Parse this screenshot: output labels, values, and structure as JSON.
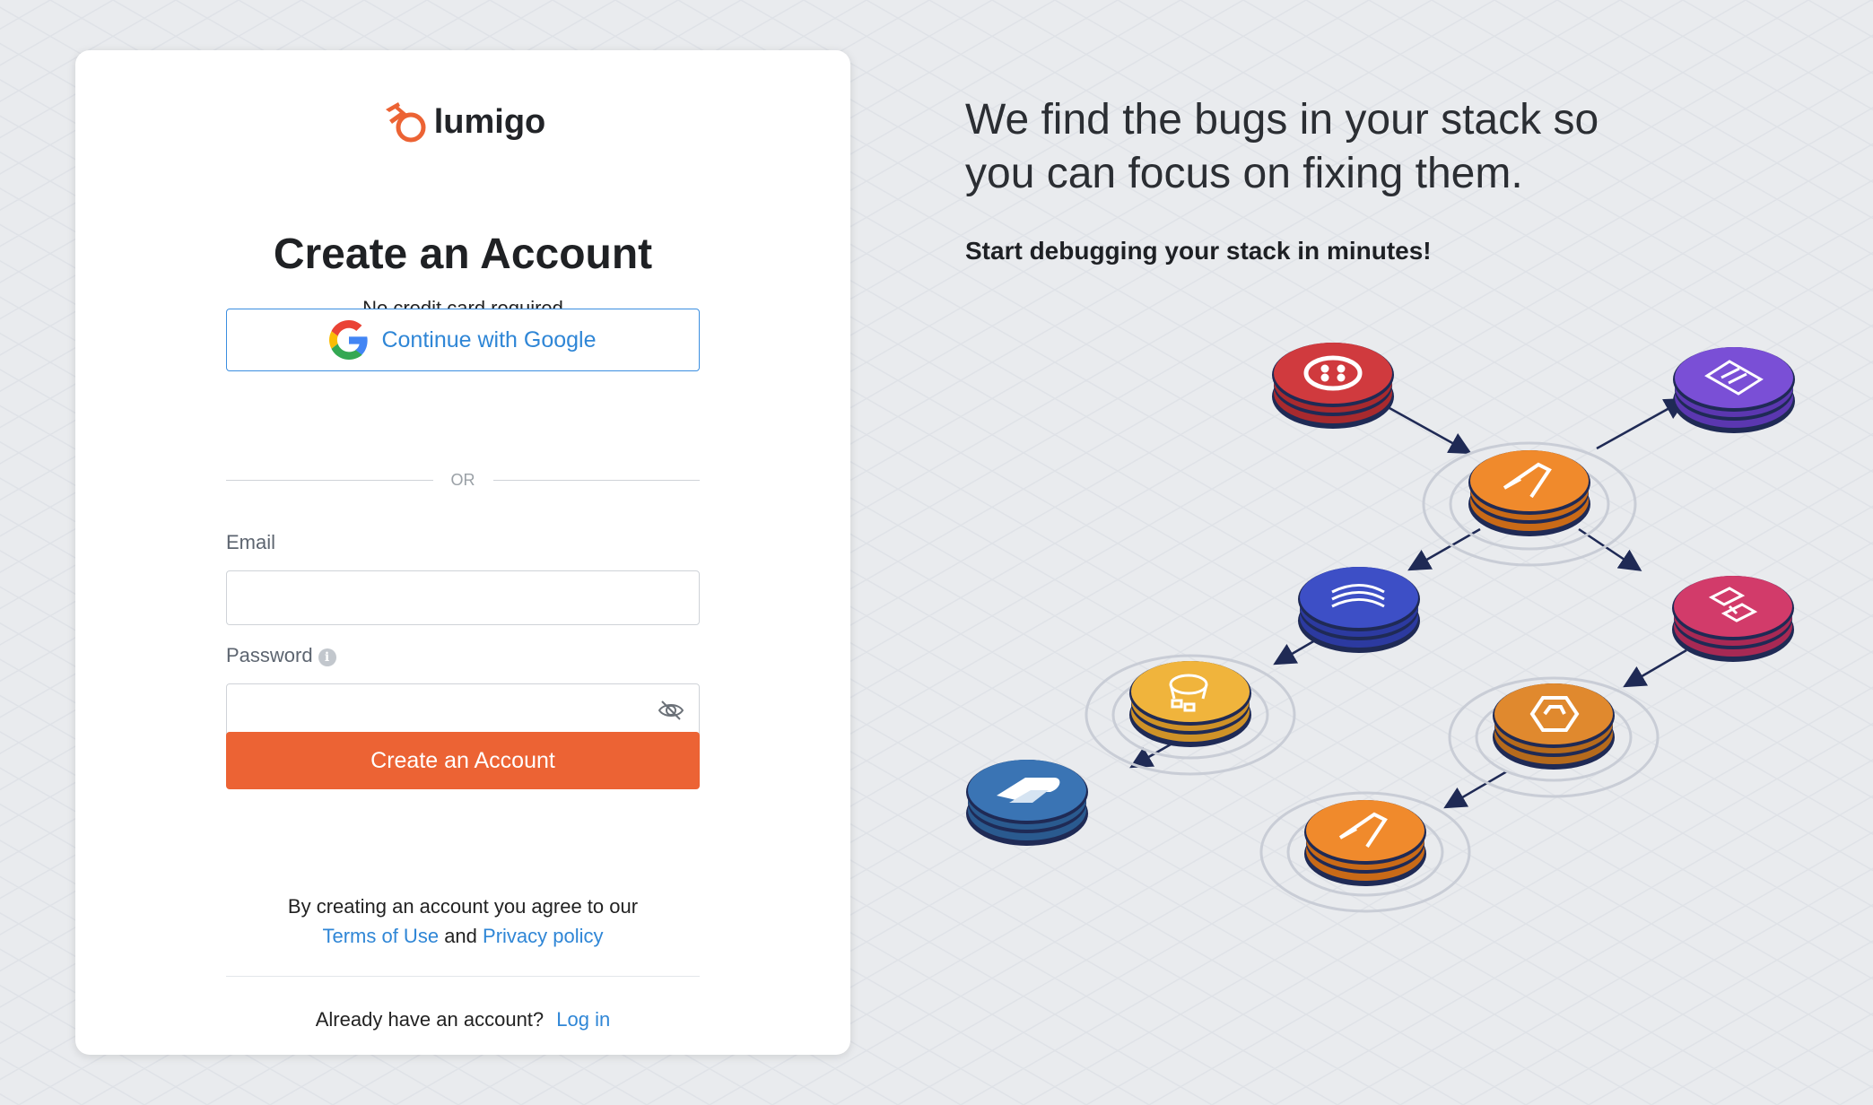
{
  "brand": {
    "name": "lumigo",
    "accent_color": "#ec6334",
    "link_color": "#2f86d6"
  },
  "card": {
    "title": "Create an Account",
    "subtitle": "No credit card required",
    "google_button_label": "Continue with Google",
    "divider_text": "OR",
    "email_label": "Email",
    "email_value": "",
    "password_label": "Password",
    "password_value": "",
    "submit_label": "Create an Account",
    "terms_prefix": "By creating an account you agree to our",
    "terms_link": "Terms of Use",
    "terms_and": "and",
    "privacy_link": "Privacy policy",
    "login_prompt": "Already have an account?",
    "login_link": "Log in"
  },
  "hero": {
    "headline_line1": "We find the bugs in your stack so",
    "headline_line2": "you can focus on fixing them.",
    "subheadline": "Start debugging your stack in minutes!"
  },
  "illustration": {
    "nodes": [
      {
        "name": "twilio",
        "icon": "twilio-icon",
        "color": "#c8363a"
      },
      {
        "name": "api-gateway",
        "icon": "api-gateway-icon",
        "color": "#7a4fd6"
      },
      {
        "name": "lambda-top",
        "icon": "lambda-icon",
        "color": "#f08a2c"
      },
      {
        "name": "kinesis",
        "icon": "kinesis-icon",
        "color": "#3d4fc6"
      },
      {
        "name": "step-functions",
        "icon": "step-functions-icon",
        "color": "#d23b6a"
      },
      {
        "name": "s3",
        "icon": "s3-icon",
        "color": "#f0b43c"
      },
      {
        "name": "eventbridge",
        "icon": "eventbridge-icon",
        "color": "#e0892e"
      },
      {
        "name": "paypal",
        "icon": "paypal-icon",
        "color": "#3a74b4"
      },
      {
        "name": "lambda-bottom",
        "icon": "lambda-icon",
        "color": "#f08a2c"
      }
    ]
  }
}
